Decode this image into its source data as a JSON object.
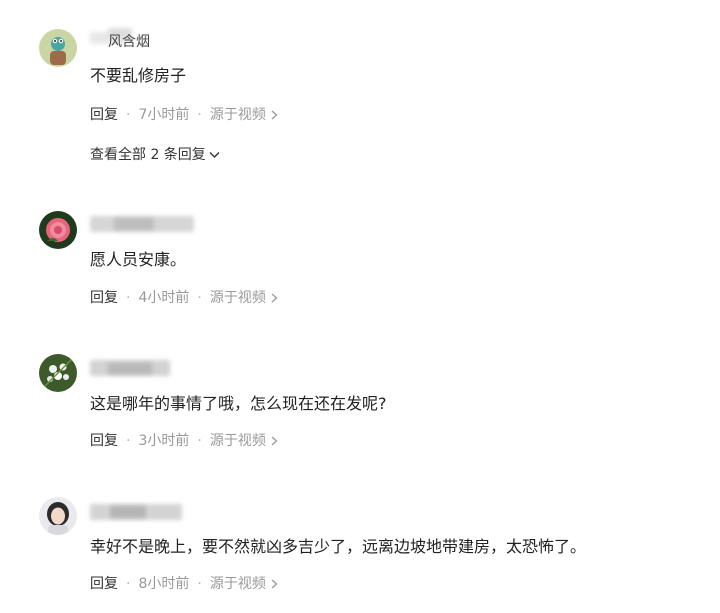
{
  "comments": [
    {
      "username": "风含烟",
      "text": "不要乱修房子",
      "reply_label": "回复",
      "time": "7小时前",
      "source": "源于视频",
      "view_all": "查看全部 2 条回复"
    },
    {
      "username": "",
      "text": "愿人员安康。",
      "reply_label": "回复",
      "time": "4小时前",
      "source": "源于视频"
    },
    {
      "username": "",
      "text": "这是哪年的事情了哦，怎么现在还在发呢?",
      "reply_label": "回复",
      "time": "3小时前",
      "source": "源于视频"
    },
    {
      "username": "",
      "text": "幸好不是晚上，要不然就凶多吉少了，远离边坡地带建房，太恐怖了。",
      "reply_label": "回复",
      "time": "8小时前",
      "source": "源于视频"
    }
  ],
  "separator": "·",
  "icons": {
    "source_chevron": "chevron-right-icon",
    "expand_chevron": "chevron-down-icon"
  },
  "colors": {
    "text": "#222222",
    "meta": "#999999",
    "reply": "#333333"
  }
}
